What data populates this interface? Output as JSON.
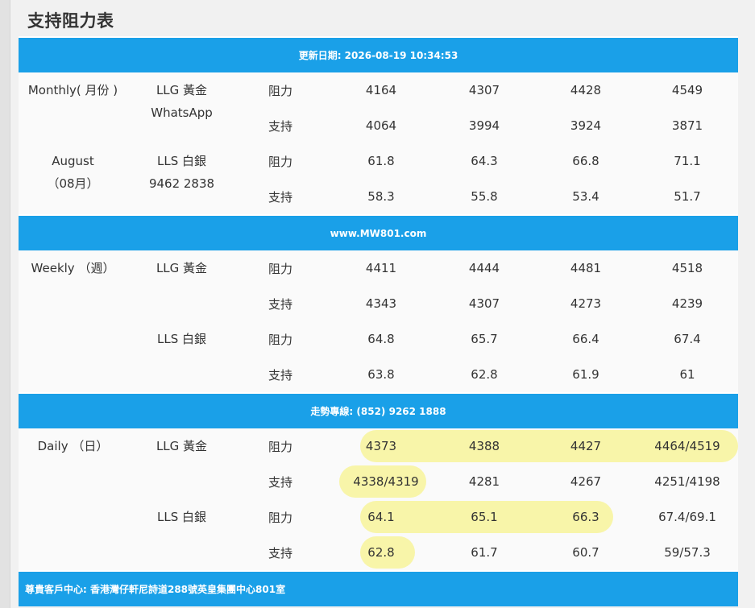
{
  "title": "支持阻力表",
  "header_band": "更新日期: 2026-08-19 10:34:53",
  "band_website": "www.MW801.com",
  "band_hotline": "走勢專線: (852) 9262 1888",
  "band_footer": "尊貴客戶中心: 香港灣仔軒尼詩道288號英皇集團中心801室",
  "monthly": {
    "period_line1": "Monthly( 月份 )",
    "period_line2": "August",
    "period_line3": "（08月）",
    "llg_label": "LLG 黃金",
    "llg_sub": "WhatsApp",
    "lls_label": "LLS 白銀",
    "lls_sub": "9462 2838",
    "rows": [
      {
        "type": "阻力",
        "values": [
          "4164",
          "4307",
          "4428",
          "4549"
        ]
      },
      {
        "type": "支持",
        "values": [
          "4064",
          "3994",
          "3924",
          "3871"
        ]
      },
      {
        "type": "阻力",
        "values": [
          "61.8",
          "64.3",
          "66.8",
          "71.1"
        ]
      },
      {
        "type": "支持",
        "values": [
          "58.3",
          "55.8",
          "53.4",
          "51.7"
        ]
      }
    ]
  },
  "weekly": {
    "period": "Weekly （週）",
    "llg_label": "LLG 黃金",
    "lls_label": "LLS 白銀",
    "rows": [
      {
        "type": "阻力",
        "values": [
          "4411",
          "4444",
          "4481",
          "4518"
        ]
      },
      {
        "type": "支持",
        "values": [
          "4343",
          "4307",
          "4273",
          "4239"
        ]
      },
      {
        "type": "阻力",
        "values": [
          "64.8",
          "65.7",
          "66.4",
          "67.4"
        ]
      },
      {
        "type": "支持",
        "values": [
          "63.8",
          "62.8",
          "61.9",
          "61"
        ]
      }
    ]
  },
  "daily": {
    "period": "Daily （日）",
    "llg_label": "LLG 黃金",
    "lls_label": "LLS 白銀",
    "rows": [
      {
        "type": "阻力",
        "values": [
          "4373",
          "4388",
          "4427",
          "4464/4519"
        ]
      },
      {
        "type": "支持",
        "values": [
          "4338/4319",
          "4281",
          "4267",
          "4251/4198"
        ]
      },
      {
        "type": "阻力",
        "values": [
          "64.1",
          "65.1",
          "66.3",
          "67.4/69.1"
        ]
      },
      {
        "type": "支持",
        "values": [
          "62.8",
          "61.7",
          "60.7",
          "59/57.3"
        ]
      }
    ]
  },
  "highlight_color": "#f7f39a",
  "band_color": "#1aa0e8"
}
